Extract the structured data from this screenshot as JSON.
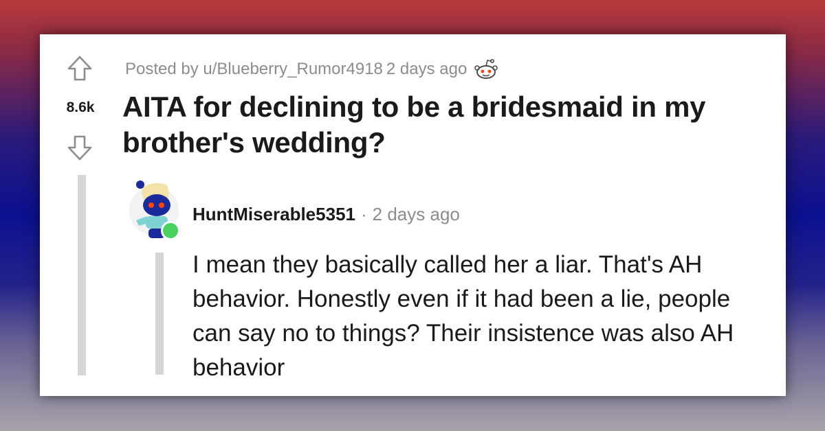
{
  "post": {
    "score": "8.6k",
    "posted_by": "Posted by u/Blueberry_Rumor4918",
    "time": "2 days ago",
    "title": "AITA for declining to be a bridesmaid in my brother's wedding?",
    "award_icon": "reddit-snoo-award-icon"
  },
  "comment": {
    "username": "HuntMiserable5351",
    "separator": "·",
    "time": "2 days ago",
    "body": "I mean they basically called her a liar. That's AH behavior. Honestly even if it had been a lie, people can say no to things? Their insistence was also AH behavior",
    "online_color": "#46d160"
  },
  "icons": {
    "upvote": "upvote-arrow-icon",
    "downvote": "downvote-arrow-icon",
    "avatar": "snoo-avatar"
  }
}
